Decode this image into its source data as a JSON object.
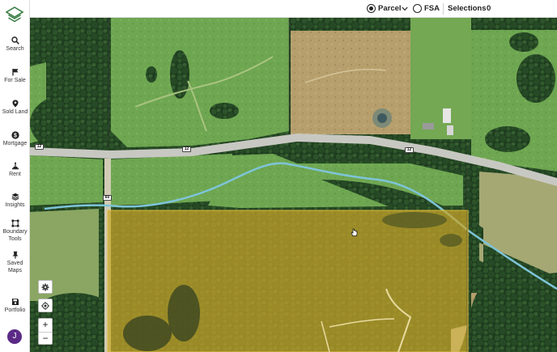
{
  "sidebar": {
    "items": [
      {
        "label": "Search",
        "icon": "search-icon"
      },
      {
        "label": "For Sale",
        "icon": "flag-icon"
      },
      {
        "label": "Sold Land",
        "icon": "location-pin-icon"
      },
      {
        "label": "Mortgage",
        "icon": "dollar-icon"
      },
      {
        "label": "Rent",
        "icon": "rent-icon"
      },
      {
        "label": "Insights",
        "icon": "layers-icon"
      },
      {
        "label": "Boundary",
        "icon": "boundary-icon"
      },
      {
        "label": "Tools",
        "icon": "boundary-icon"
      },
      {
        "label": "Saved",
        "icon": "pin-icon"
      },
      {
        "label": "Maps",
        "icon": "pin-icon"
      },
      {
        "label": "Portfolio",
        "icon": "save-icon"
      }
    ],
    "avatar_initial": "J"
  },
  "topbar": {
    "parcel_label": "Parcel",
    "fsa_label": "FSA",
    "selections_label": "Selections",
    "selections_count": "0",
    "selected_mode": "Parcel"
  },
  "map": {
    "road_shields": [
      "12",
      "12",
      "12",
      "60"
    ],
    "zoom_in": "+",
    "zoom_out": "−",
    "parcel_highlight_color": "#d9b21a"
  }
}
